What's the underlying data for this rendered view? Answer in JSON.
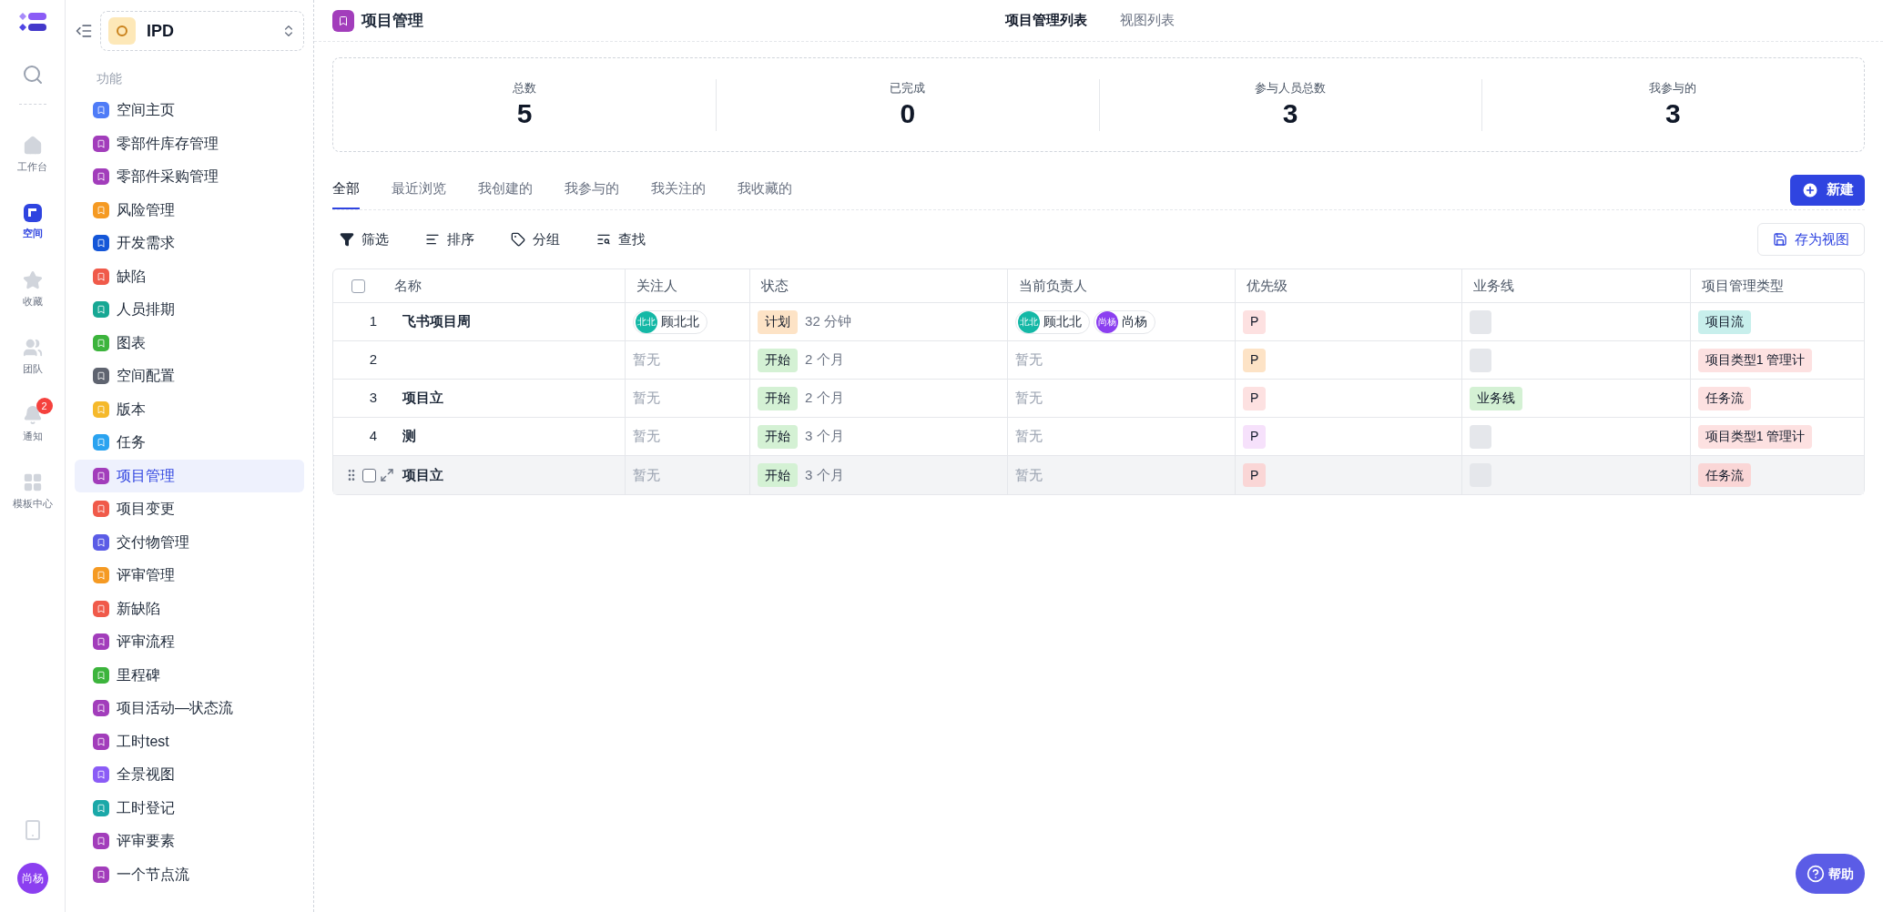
{
  "rail": {
    "items": [
      {
        "kind": "search"
      },
      {
        "kind": "home",
        "label": "工作台",
        "selected": false
      },
      {
        "kind": "space",
        "label": "空间",
        "selected": true
      },
      {
        "kind": "star",
        "label": "收藏",
        "selected": false
      },
      {
        "kind": "team",
        "label": "团队",
        "selected": false
      },
      {
        "kind": "bell",
        "label": "通知",
        "selected": false,
        "badge": "2"
      },
      {
        "kind": "grid",
        "label": "模板中心",
        "selected": false
      }
    ],
    "user": "尚杨"
  },
  "sidebar": {
    "space": "IPD",
    "section": "功能",
    "items": [
      {
        "label": "空间主页",
        "color": "#4f7cf7",
        "selected": false
      },
      {
        "label": "零部件库存管理",
        "color": "#a23dbb",
        "selected": false
      },
      {
        "label": "零部件采购管理",
        "color": "#a23dbb",
        "selected": false
      },
      {
        "label": "风险管理",
        "color": "#f59a23",
        "selected": false
      },
      {
        "label": "开发需求",
        "color": "#1456d8",
        "selected": false
      },
      {
        "label": "缺陷",
        "color": "#f05a4a",
        "selected": false
      },
      {
        "label": "人员排期",
        "color": "#17a894",
        "selected": false
      },
      {
        "label": "图表",
        "color": "#3cb43c",
        "selected": false
      },
      {
        "label": "空间配置",
        "color": "#5f6470",
        "selected": false
      },
      {
        "label": "版本",
        "color": "#f5b92b",
        "selected": false
      },
      {
        "label": "任务",
        "color": "#2aa3f0",
        "selected": false
      },
      {
        "label": "项目管理",
        "color": "#a23dbb",
        "selected": true
      },
      {
        "label": "项目变更",
        "color": "#f05a4a",
        "selected": false
      },
      {
        "label": "交付物管理",
        "color": "#5b5ce6",
        "selected": false
      },
      {
        "label": "评审管理",
        "color": "#f59a23",
        "selected": false
      },
      {
        "label": "新缺陷",
        "color": "#f05a4a",
        "selected": false
      },
      {
        "label": "评审流程",
        "color": "#a23dbb",
        "selected": false
      },
      {
        "label": "里程碑",
        "color": "#3cb43c",
        "selected": false
      },
      {
        "label": "项目活动—状态流",
        "color": "#a23dbb",
        "selected": false
      },
      {
        "label": "工时test",
        "color": "#a23dbb",
        "selected": false
      },
      {
        "label": "全景视图",
        "color": "#8b5cf6",
        "selected": false
      },
      {
        "label": "工时登记",
        "color": "#1aa8a8",
        "selected": false
      },
      {
        "label": "评审要素",
        "color": "#a23dbb",
        "selected": false
      },
      {
        "label": "一个节点流",
        "color": "#a23dbb",
        "selected": false
      }
    ]
  },
  "header": {
    "title": "项目管理",
    "views": [
      {
        "label": "项目管理列表",
        "selected": true
      },
      {
        "label": "视图列表",
        "selected": false
      }
    ]
  },
  "stats": [
    {
      "label": "总数",
      "value": "5"
    },
    {
      "label": "已完成",
      "value": "0"
    },
    {
      "label": "参与人员总数",
      "value": "3"
    },
    {
      "label": "我参与的",
      "value": "3"
    }
  ],
  "tabs": [
    {
      "label": "全部",
      "selected": true
    },
    {
      "label": "最近浏览",
      "selected": false
    },
    {
      "label": "我创建的",
      "selected": false
    },
    {
      "label": "我参与的",
      "selected": false
    },
    {
      "label": "我关注的",
      "selected": false
    },
    {
      "label": "我收藏的",
      "selected": false
    }
  ],
  "new_button": "新建",
  "toolbar": [
    {
      "kind": "filter",
      "label": "筛选"
    },
    {
      "kind": "sort",
      "label": "排序"
    },
    {
      "kind": "group",
      "label": "分组"
    },
    {
      "kind": "find",
      "label": "查找"
    }
  ],
  "save_view": "存为视图",
  "table": {
    "all_checked": false,
    "columns": [
      "名称",
      "关注人",
      "状态",
      "当前负责人",
      "优先级",
      "业务线",
      "项目管理类型"
    ],
    "rows": [
      {
        "index": "1",
        "hovered": false,
        "name": "飞书项目周",
        "followers": [
          {
            "avatar": "北北",
            "name": "顾北北",
            "color": "#14b8a6"
          }
        ],
        "status": {
          "label": "计划",
          "color": "#fde3c6"
        },
        "duration": "32 分钟",
        "owners": [
          {
            "avatar": "北北",
            "name": "顾北北",
            "color": "#14b8a6"
          },
          {
            "avatar": "尚杨",
            "name": "尚杨",
            "color": "#8b3ff0"
          }
        ],
        "priority": {
          "label": "P",
          "color": "#fde1e1"
        },
        "type": {
          "label": "项目流",
          "color": "#c8efec"
        }
      },
      {
        "index": "2",
        "hovered": false,
        "followers_empty": "暂无",
        "status": {
          "label": "开始",
          "color": "#d4f1d4"
        },
        "duration": "2 个月",
        "owners_empty": "暂无",
        "priority": {
          "label": "P",
          "color": "#fde3c6"
        },
        "type": {
          "label": "项目类型1 管理计",
          "color": "#fde1e1"
        }
      },
      {
        "index": "3",
        "hovered": false,
        "name": "项目立",
        "followers_empty": "暂无",
        "status": {
          "label": "开始",
          "color": "#d4f1d4"
        },
        "duration": "2 个月",
        "owners_empty": "暂无",
        "priority": {
          "label": "P",
          "color": "#fde1e1"
        },
        "business_line": {
          "label": "业务线",
          "color": "#d4f1d4"
        },
        "type": {
          "label": "任务流",
          "color": "#fde1e1"
        }
      },
      {
        "index": "4",
        "hovered": false,
        "name": "测",
        "followers_empty": "暂无",
        "status": {
          "label": "开始",
          "color": "#d4f1d4"
        },
        "duration": "3 个月",
        "owners_empty": "暂无",
        "priority": {
          "label": "P",
          "color": "#f6e1fb"
        },
        "type": {
          "label": "项目类型1 管理计",
          "color": "#fde1e1"
        }
      },
      {
        "hovered": true,
        "checked": false,
        "name": "项目立",
        "followers_empty": "暂无",
        "status": {
          "label": "开始",
          "color": "#d4f1d4"
        },
        "duration": "3 个月",
        "owners_empty": "暂无",
        "priority": {
          "label": "P",
          "color": "#fad6d6"
        },
        "type": {
          "label": "任务流",
          "color": "#fad6d6"
        }
      }
    ]
  },
  "help": "帮助"
}
